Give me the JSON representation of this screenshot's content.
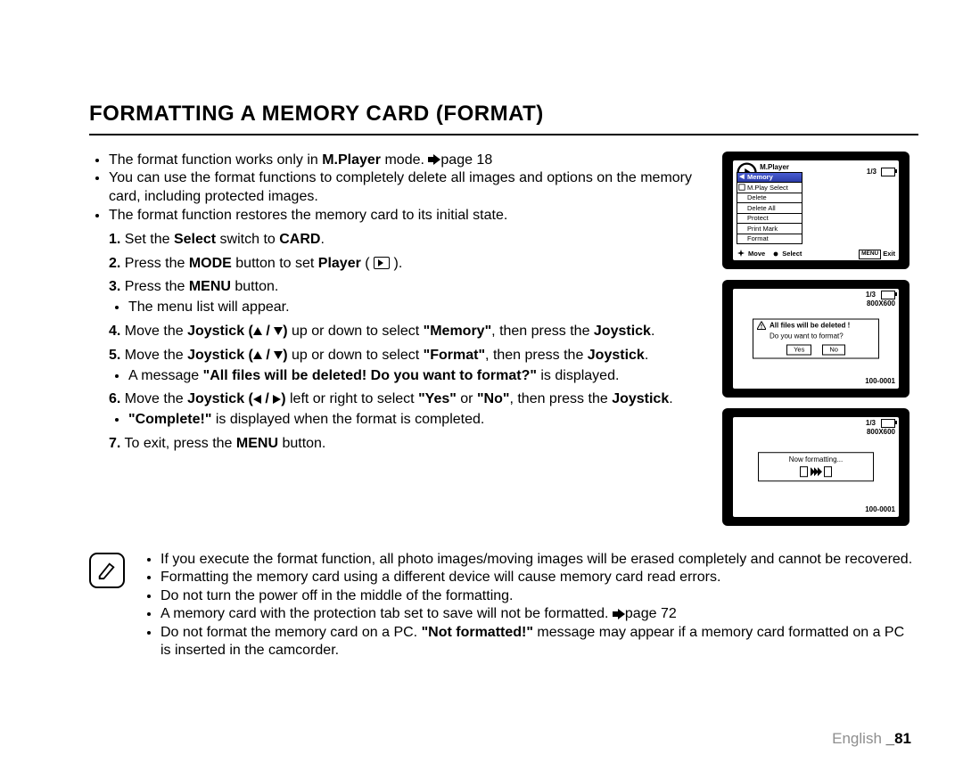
{
  "title": "FORMATTING A MEMORY CARD (FORMAT)",
  "intro": {
    "b1a": "The format function works only in ",
    "b1b": "M.Player",
    "b1c": " mode. ",
    "b1d": "page 18",
    "b2": "You can use the format functions to completely delete all images and options on the memory card, including protected images.",
    "b3": "The format function restores the memory card to its initial state."
  },
  "steps": {
    "s1a": "Set the ",
    "s1b": "Select",
    "s1c": " switch to ",
    "s1d": "CARD",
    "s1e": ".",
    "s2a": "Press the ",
    "s2b": "MODE",
    "s2c": " button to set ",
    "s2d": "Player",
    "s2e": " ( ",
    "s2f": " ).",
    "s3a": "Press the ",
    "s3b": "MENU",
    "s3c": " button.",
    "s3sub": "The menu list will appear.",
    "s4a": "Move the ",
    "s4b": "Joystick (",
    "s4c": " / ",
    "s4d": ")",
    "s4e": " up or down to select ",
    "s4f": "\"Memory\"",
    "s4g": ", then press the ",
    "s4h": "Joystick",
    "s4i": ".",
    "s5a": "Move the ",
    "s5b": "Joystick (",
    "s5c": " / ",
    "s5d": ")",
    "s5e": " up or down to select ",
    "s5f": "\"Format\"",
    "s5g": ", then press the ",
    "s5h": "Joystick",
    "s5i": ".",
    "s5suba": "A message ",
    "s5subb": "\"All files will be deleted! Do you want to format?\"",
    "s5subc": " is displayed.",
    "s6a": "Move the ",
    "s6b": "Joystick (",
    "s6c": " / ",
    "s6d": ")",
    "s6e": " left or right to select ",
    "s6f": "\"Yes\"",
    "s6g": " or ",
    "s6h": "\"No\"",
    "s6i": ", then press the ",
    "s6j": "Joystick",
    "s6k": ".",
    "s6suba": "\"Complete!\"",
    "s6subb": " is displayed when the format is completed.",
    "s7a": "To exit, press the ",
    "s7b": "MENU",
    "s7c": " button."
  },
  "notes": {
    "n1": "If you execute the format function, all photo images/moving images will be erased completely and cannot be recovered.",
    "n2": "Formatting the memory card using a different device will cause memory card read errors.",
    "n3": "Do not turn the power off in the middle of the formatting.",
    "n4a": "A memory card with the protection tab set to save will not be formatted. ",
    "n4b": "page 72",
    "n5a": "Do not format the memory card on a PC. ",
    "n5b": "\"Not formatted!\"",
    "n5c": " message may appear if a memory card formatted on a PC is inserted in the camcorder."
  },
  "lcd": {
    "s1": {
      "mode": "M.Player Mode",
      "pager": "1/3",
      "menu": [
        "Memory",
        "M.Play Select",
        "Delete",
        "Delete All",
        "Protect",
        "Print Mark",
        "Format"
      ],
      "foot_move": "Move",
      "foot_select": "Select",
      "foot_menu": "MENU",
      "foot_exit": "Exit"
    },
    "s2": {
      "pager": "1/3",
      "res": "800X600",
      "msg1": "All files will be deleted !",
      "msg2": "Do you want to format?",
      "yes": "Yes",
      "no": "No",
      "id": "100-0001"
    },
    "s3": {
      "pager": "1/3",
      "res": "800X600",
      "msg": "Now formatting...",
      "id": "100-0001"
    }
  },
  "footer": {
    "lang": "English ",
    "page": "_81"
  }
}
